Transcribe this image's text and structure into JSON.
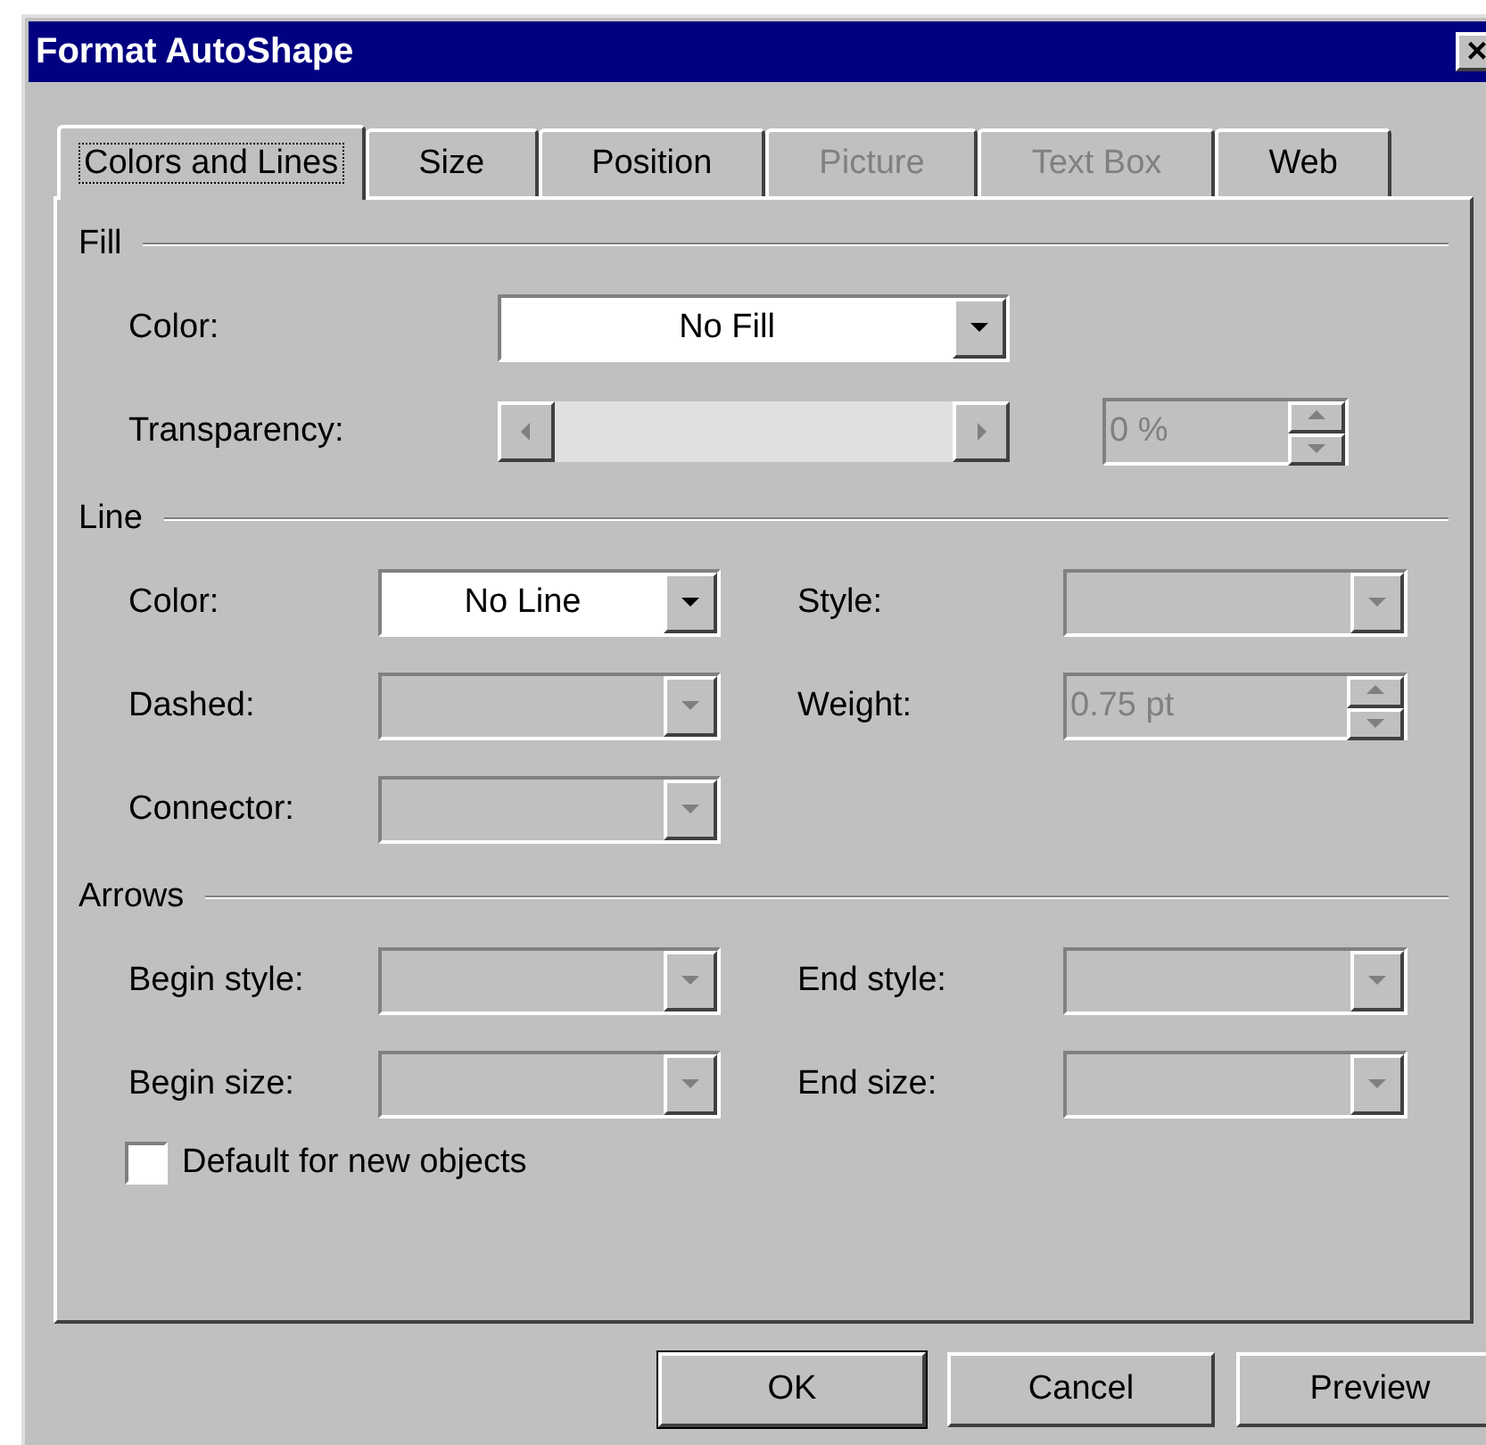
{
  "window": {
    "title": "Format AutoShape",
    "close": "×"
  },
  "tabs": [
    {
      "label": "Colors and Lines",
      "selected": true,
      "disabled": false
    },
    {
      "label": "Size",
      "selected": false,
      "disabled": false
    },
    {
      "label": "Position",
      "selected": false,
      "disabled": false
    },
    {
      "label": "Picture",
      "selected": false,
      "disabled": true
    },
    {
      "label": "Text Box",
      "selected": false,
      "disabled": true
    },
    {
      "label": "Web",
      "selected": false,
      "disabled": false
    }
  ],
  "sections": [
    {
      "title": "Fill",
      "kind": "single",
      "rows": [
        [
          {
            "label": "Color:",
            "control": {
              "kind": "dropdown",
              "value": "No Fill",
              "disabled": false
            }
          }
        ],
        [
          {
            "label": "Transparency:",
            "control": {
              "kind": "slider",
              "disabled": true
            }
          },
          {
            "control": {
              "kind": "spinner",
              "value": "0 %",
              "disabled": true
            }
          }
        ]
      ]
    },
    {
      "title": "Line",
      "kind": "paired",
      "rows": [
        [
          {
            "label": "Color:",
            "control": {
              "kind": "dropdown",
              "value": "No Line",
              "disabled": false
            }
          },
          {
            "label": "Style:",
            "control": {
              "kind": "dropdown",
              "disabled": true
            }
          }
        ],
        [
          {
            "label": "Dashed:",
            "control": {
              "kind": "dropdown",
              "disabled": true
            }
          },
          {
            "label": "Weight:",
            "control": {
              "kind": "spinner",
              "value": "0.75 pt",
              "disabled": true
            }
          }
        ],
        [
          {
            "label": "Connector:",
            "control": {
              "kind": "dropdown",
              "disabled": true
            }
          }
        ]
      ]
    },
    {
      "title": "Arrows",
      "kind": "paired",
      "rows": [
        [
          {
            "label": "Begin style:",
            "control": {
              "kind": "dropdown",
              "disabled": true
            }
          },
          {
            "label": "End style:",
            "control": {
              "kind": "dropdown",
              "disabled": true
            }
          }
        ],
        [
          {
            "label": "Begin size:",
            "control": {
              "kind": "dropdown",
              "disabled": true
            }
          },
          {
            "label": "End size:",
            "control": {
              "kind": "dropdown",
              "disabled": true
            }
          }
        ]
      ]
    }
  ],
  "checkbox": {
    "label": "Default for new objects",
    "checked": false
  },
  "buttons": [
    {
      "label": "OK",
      "default": true
    },
    {
      "label": "Cancel",
      "default": false
    },
    {
      "label": "Preview",
      "default": false
    }
  ]
}
